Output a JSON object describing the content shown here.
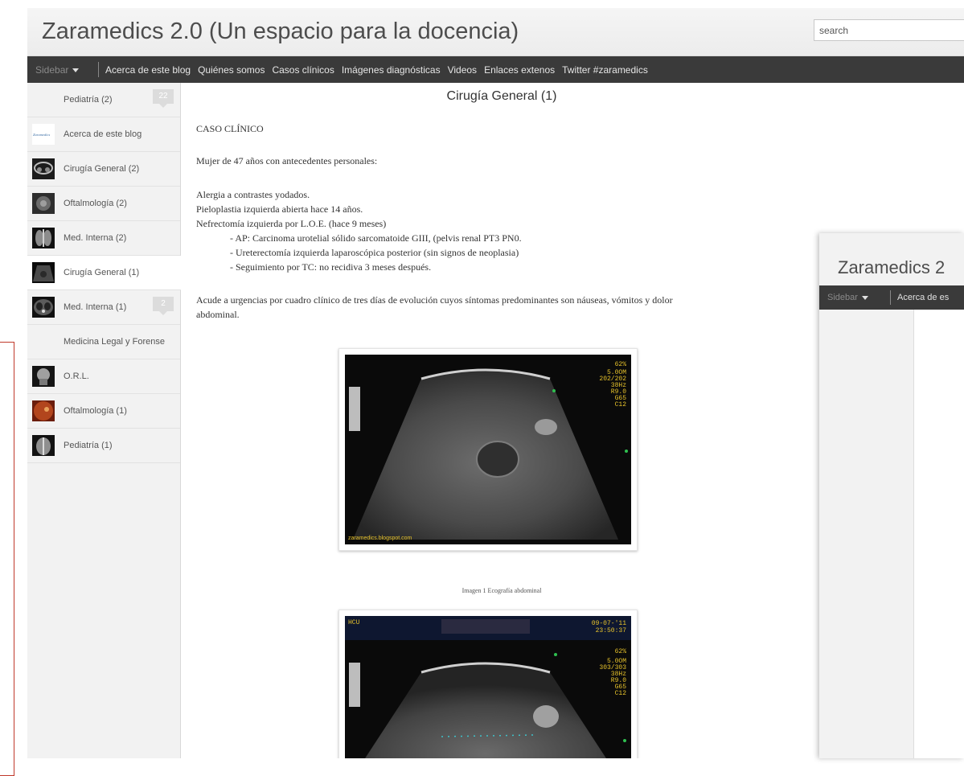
{
  "header": {
    "title": "Zaramedics 2.0 (Un espacio para la docencia)",
    "search_placeholder": "search"
  },
  "navbar": {
    "sidebar_label": "Sidebar",
    "items": [
      "Acerca de este blog",
      "Quiénes somos",
      "Casos clínicos",
      "Imágenes diagnósticas",
      "Videos",
      "Enlaces extenos",
      "Twitter #zaramedics"
    ]
  },
  "sidebar": {
    "items": [
      {
        "label": "Pediatría (2)",
        "badge": "22",
        "thumb": "none"
      },
      {
        "label": "Acerca de este blog",
        "badge": "",
        "thumb": "logo",
        "thumb_text": "Zaramedics"
      },
      {
        "label": "Cirugía General (2)",
        "badge": "",
        "thumb": "pelvis-xray"
      },
      {
        "label": "Oftalmología (2)",
        "badge": "",
        "thumb": "eye"
      },
      {
        "label": "Med. Interna (2)",
        "badge": "",
        "thumb": "chest-xray"
      },
      {
        "label": "Cirugía General (1)",
        "badge": "",
        "thumb": "ultrasound",
        "active": true
      },
      {
        "label": "Med. Interna (1)",
        "badge": "2",
        "thumb": "ct"
      },
      {
        "label": "Medicina Legal y Forense",
        "badge": "",
        "thumb": "none"
      },
      {
        "label": "O.R.L.",
        "badge": "",
        "thumb": "skull-xray"
      },
      {
        "label": "Oftalmología (1)",
        "badge": "",
        "thumb": "retina"
      },
      {
        "label": "Pediatría (1)",
        "badge": "",
        "thumb": "child-xray"
      }
    ]
  },
  "post": {
    "title": "Cirugía General (1)",
    "heading": "CASO CLÍNICO",
    "intro": "Mujer de 47 años con antecedentes personales:",
    "history": [
      "Alergia a contrastes yodados.",
      "Pieloplastia izquierda abierta hace 14 años.",
      "Nefrectomía izquierda por L.O.E. (hace 9 meses)"
    ],
    "history_sub": [
      "- AP: Carcinoma urotelial sólido sarcomatoide GIII, (pelvis renal PT3 PN0.",
      "- Ureterectomía izquierda laparoscópica posterior (sin signos de neoplasia)",
      "- Seguimiento por TC: no recidiva 3 meses después."
    ],
    "presentation_line1": "Acude a urgencias por cuadro clínico de tres días de evolución cuyos síntomas predominantes son náuseas, vómitos y dolor",
    "presentation_line2": "abdominal.",
    "image1": {
      "watermark": "zaramedics.blogspot.com",
      "overlay_lines": [
        "62%",
        "5.0OM",
        "202/202",
        "38Hz",
        "R9.0",
        "G65",
        "C12"
      ]
    },
    "caption": "Imagen 1 Ecografía abdominal",
    "image2": {
      "top_left": "HCU",
      "date": "09-07-'11",
      "time": "23:50:37",
      "overlay_lines": [
        "62%",
        "5.0OM",
        "303/303",
        "38Hz",
        "R9.0",
        "G65",
        "C12"
      ]
    }
  },
  "second_window": {
    "title": "Zaramedics 2",
    "sidebar_label": "Sidebar",
    "nav_item": "Acerca de es"
  }
}
